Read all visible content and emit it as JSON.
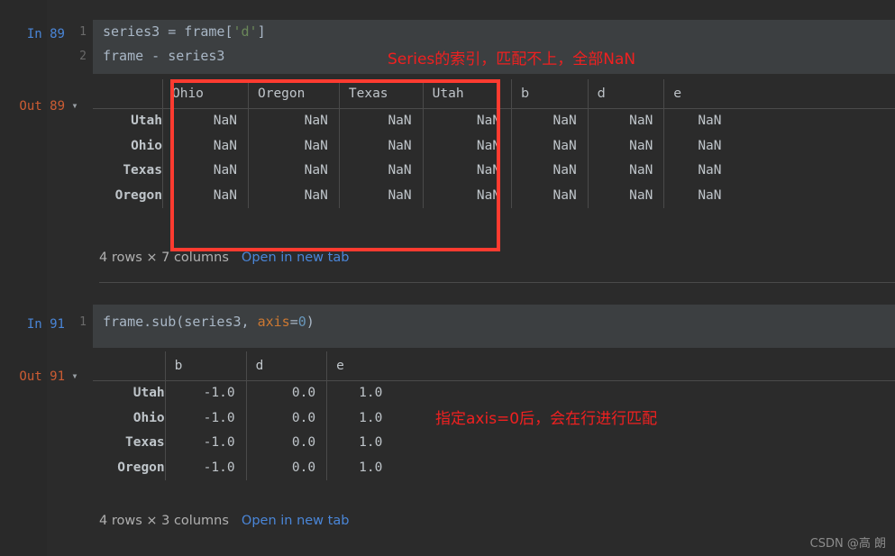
{
  "theme": {
    "background": "#2b2b2b",
    "code_background": "#3c3f41",
    "gutter_background": "#292929",
    "text": "#a9b7c6",
    "in_prompt_color": "#4a86d8",
    "out_prompt_color": "#cc5c33",
    "link_color": "#4a86d8",
    "annotation_color": "#f02020",
    "grid_line": "#4a4a4a"
  },
  "cells": [
    {
      "kind": "input",
      "prompt": "In 89",
      "line_numbers": [
        "1",
        "2"
      ],
      "lines": [
        [
          {
            "text": "series3 = frame[",
            "type": "plain"
          },
          {
            "text": "'d'",
            "type": "string"
          },
          {
            "text": "]",
            "type": "plain"
          }
        ],
        [
          {
            "text": "frame - series3",
            "type": "plain"
          }
        ]
      ]
    },
    {
      "kind": "output",
      "prompt": "Out 89",
      "chevron": "chevron-down-icon",
      "table": {
        "index_header": "",
        "columns": [
          "Ohio",
          "Oregon",
          "Texas",
          "Utah",
          "b",
          "d",
          "e"
        ],
        "index": [
          "Utah",
          "Ohio",
          "Texas",
          "Oregon"
        ],
        "rows": [
          [
            "NaN",
            "NaN",
            "NaN",
            "NaN",
            "NaN",
            "NaN",
            "NaN"
          ],
          [
            "NaN",
            "NaN",
            "NaN",
            "NaN",
            "NaN",
            "NaN",
            "NaN"
          ],
          [
            "NaN",
            "NaN",
            "NaN",
            "NaN",
            "NaN",
            "NaN",
            "NaN"
          ],
          [
            "NaN",
            "NaN",
            "NaN",
            "NaN",
            "NaN",
            "NaN",
            "NaN"
          ]
        ]
      },
      "footer": {
        "shape": "4 rows × 7 columns",
        "open_link": "Open in new tab"
      }
    },
    {
      "kind": "input",
      "prompt": "In 91",
      "line_numbers": [
        "1"
      ],
      "lines": [
        [
          {
            "text": "frame.sub(series3, ",
            "type": "plain"
          },
          {
            "text": "axis",
            "type": "kwarg"
          },
          {
            "text": "=",
            "type": "plain"
          },
          {
            "text": "0",
            "type": "number"
          },
          {
            "text": ")",
            "type": "plain"
          }
        ]
      ]
    },
    {
      "kind": "output",
      "prompt": "Out 91",
      "chevron": "chevron-down-icon",
      "table": {
        "index_header": "",
        "columns": [
          "b",
          "d",
          "e"
        ],
        "index": [
          "Utah",
          "Ohio",
          "Texas",
          "Oregon"
        ],
        "rows": [
          [
            "-1.0",
            "0.0",
            "1.0"
          ],
          [
            "-1.0",
            "0.0",
            "1.0"
          ],
          [
            "-1.0",
            "0.0",
            "1.0"
          ],
          [
            "-1.0",
            "0.0",
            "1.0"
          ]
        ]
      },
      "footer": {
        "shape": "4 rows × 3 columns",
        "open_link": "Open in new tab"
      }
    }
  ],
  "annotations": {
    "note_top": "Series的索引，匹配不上，全部NaN",
    "note_bottom": "指定axis=0后，会在行进行匹配"
  },
  "watermark": "CSDN @高 朗"
}
